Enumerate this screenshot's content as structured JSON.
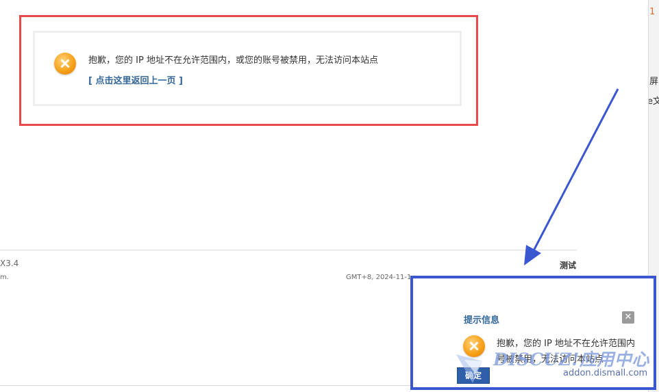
{
  "colors": {
    "annotation_red": "#e84a4a",
    "annotation_blue": "#3a56d0",
    "link": "#336699",
    "icon_orange": "#f7a21b"
  },
  "message_page": {
    "message": "抱歉，您的 IP 地址不在允许范围内，或您的账号被禁用，无法访问本站点",
    "back_link": "[ 点击这里返回上一页 ]",
    "icon": "error-x-icon"
  },
  "footer": {
    "version": "X3.4",
    "left_text": "m.",
    "right_label": "测试",
    "time_info": "GMT+8, 2024-11-1"
  },
  "right_strip": {
    "items": [
      "1",
      "屏",
      "e文"
    ]
  },
  "dialog": {
    "title": "提示信息",
    "close_label": "✕",
    "message_line1": "抱歉，您的 IP 地址不在允许范围内",
    "message_line2": "号被禁用，无法访问本站点",
    "ok_label": "确定",
    "icon": "error-x-icon"
  },
  "watermark": {
    "brand": "DISCUZ!应用中心",
    "url": "addon.dismall.com"
  }
}
